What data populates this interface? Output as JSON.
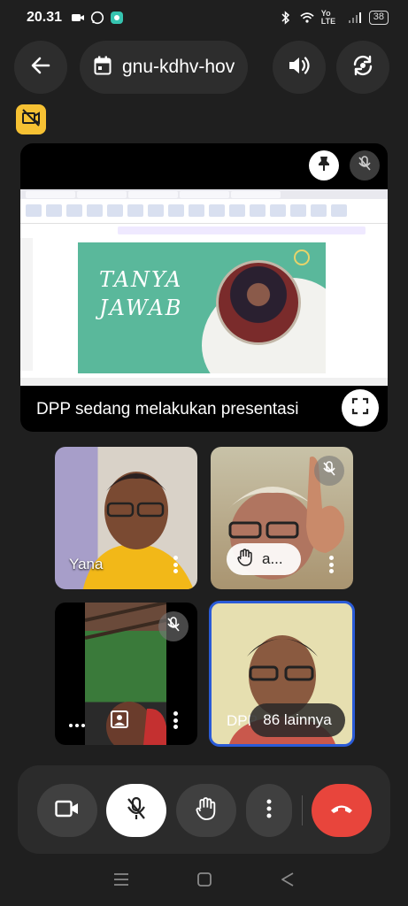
{
  "status_bar": {
    "time": "20.31",
    "lte": "Yo LTE",
    "battery": "38"
  },
  "meeting": {
    "code": "gnu-kdhv-hov"
  },
  "presentation": {
    "caption": "DPP sedang melakukan presentasi",
    "slide_line1": "TANYA",
    "slide_line2": "JAWAB"
  },
  "participants": [
    {
      "name": "Yana"
    },
    {
      "name": "a..."
    },
    {
      "name": ""
    },
    {
      "name": "DPP"
    }
  ],
  "others": {
    "label": "86 lainnya"
  },
  "colors": {
    "end_call": "#e8453c",
    "active_speaker": "#2a5bd7",
    "alert": "#f6c133"
  }
}
